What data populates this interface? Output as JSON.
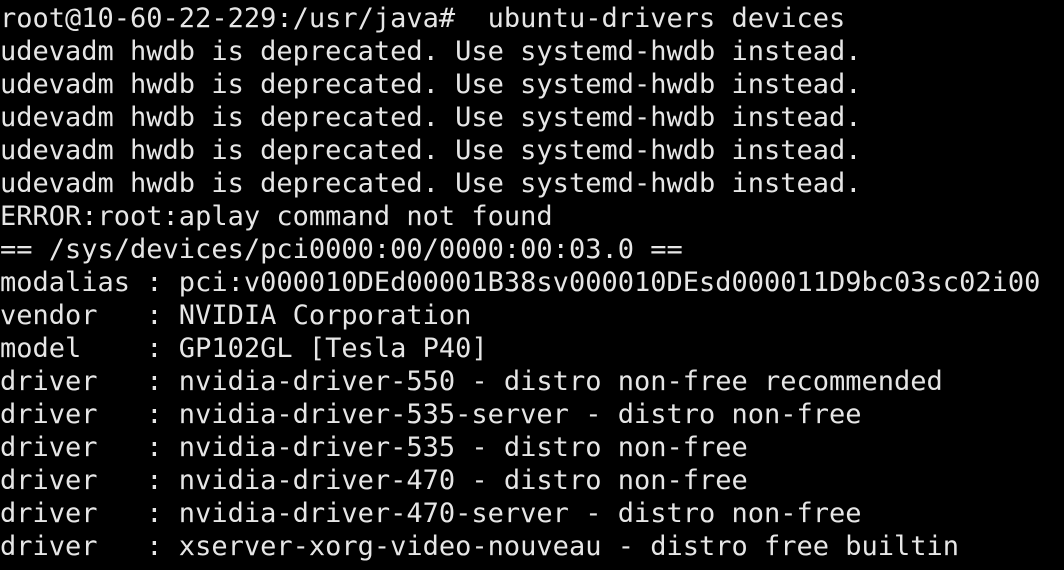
{
  "terminal": {
    "lines": [
      "root@10-60-22-229:/usr/java#  ubuntu-drivers devices",
      "udevadm hwdb is deprecated. Use systemd-hwdb instead.",
      "udevadm hwdb is deprecated. Use systemd-hwdb instead.",
      "udevadm hwdb is deprecated. Use systemd-hwdb instead.",
      "udevadm hwdb is deprecated. Use systemd-hwdb instead.",
      "udevadm hwdb is deprecated. Use systemd-hwdb instead.",
      "ERROR:root:aplay command not found",
      "== /sys/devices/pci0000:00/0000:00:03.0 ==",
      "modalias : pci:v000010DEd00001B38sv000010DEsd000011D9bc03sc02i00",
      "vendor   : NVIDIA Corporation",
      "model    : GP102GL [Tesla P40]",
      "driver   : nvidia-driver-550 - distro non-free recommended",
      "driver   : nvidia-driver-535-server - distro non-free",
      "driver   : nvidia-driver-535 - distro non-free",
      "driver   : nvidia-driver-470 - distro non-free",
      "driver   : nvidia-driver-470-server - distro non-free",
      "driver   : xserver-xorg-video-nouveau - distro free builtin"
    ]
  },
  "colors": {
    "background": "#000000",
    "foreground": "#e6e6e6"
  }
}
